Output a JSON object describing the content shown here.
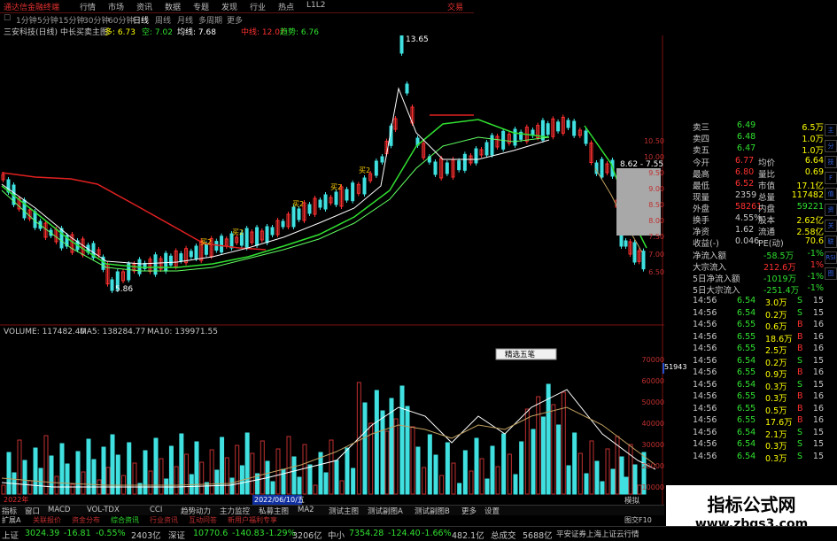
{
  "menu": {
    "app_title": "通达信金融终端",
    "items": [
      "行情",
      "市场",
      "资讯",
      "数据",
      "专题",
      "发现",
      "行业",
      "热点",
      "L1L2"
    ],
    "right_label": "交易"
  },
  "toolbar": {
    "items": [
      "1分钟",
      "5分钟",
      "15分钟",
      "30分钟",
      "60分钟",
      "日线",
      "周线",
      "月线",
      "多周期",
      "更多"
    ],
    "selected": "日线"
  },
  "info": {
    "stock": "三安科技(日线)",
    "indicator": "中长买卖主图",
    "duo": "多: 6.73",
    "kong": "空: 7.02",
    "junxian": "均线: 7.68",
    "zhongxian": "中线: 12.07",
    "qushi": "趋势: 6.76"
  },
  "price_axis": [
    "10.50",
    "10.00",
    "9.50",
    "9.00",
    "8.50",
    "8.00",
    "7.50",
    "7.00",
    "6.50"
  ],
  "volume_axis": [
    "70000",
    "60000",
    "50000",
    "40000",
    "30000",
    "20000",
    "10000"
  ],
  "volume_highlight": "51943",
  "chart_labels": {
    "high": "13.65",
    "low": "5.86",
    "range": "8.62 - 7.55",
    "volume_line": "VOLUME: 117482.40",
    "ma5_line": "MA5: 138284.77",
    "ma10_line": "MA10: 139971.55",
    "popup": "精选五笔",
    "date_start": "2022年",
    "date_cursor": "2022/06/10/五",
    "buy_markers": [
      "买2",
      "买2",
      "买2",
      "买2",
      "买2"
    ]
  },
  "quote": {
    "asks": [
      {
        "label": "卖三",
        "price": "6.49",
        "vol": "6.5万"
      },
      {
        "label": "卖四",
        "price": "6.48",
        "vol": "1.0万"
      },
      {
        "label": "卖五",
        "price": "6.47",
        "vol": "1.0万"
      }
    ],
    "stats": [
      {
        "l1": "今开",
        "v1": "6.77",
        "l2": "均价",
        "v2": "6.64"
      },
      {
        "l1": "最高",
        "v1": "6.80",
        "l2": "量比",
        "v2": "0.69"
      },
      {
        "l1": "最低",
        "v1": "6.52",
        "l2": "市值",
        "v2": "17.1亿"
      },
      {
        "l1": "现量",
        "v1": "2359",
        "l2": "总量",
        "v2": "117482"
      },
      {
        "l1": "外盘",
        "v1": "58261",
        "l2": "内盘",
        "v2": "59221"
      },
      {
        "l1": "换手",
        "v1": "4.55%",
        "l2": "股本",
        "v2": "2.62亿"
      },
      {
        "l1": "净资",
        "v1": "1.62",
        "l2": "流通",
        "v2": "2.58亿"
      },
      {
        "l1": "收益(-)",
        "v1": "0.046",
        "l2": "PE(动)",
        "v2": "70.6"
      }
    ],
    "flows": [
      {
        "label": "净流入额",
        "value": "-58.5万",
        "pct": "-1%"
      },
      {
        "label": "大宗流入",
        "value": "212.6万",
        "pct": "1%"
      },
      {
        "label": "5日净流入额",
        "value": "-1019万",
        "pct": "-1%"
      },
      {
        "label": "5日大宗流入",
        "value": "-251.4万",
        "pct": "-1%"
      }
    ],
    "ticks": [
      {
        "time": "14:56",
        "price": "6.54",
        "vol": "3.0万",
        "side": "S",
        "n": "15"
      },
      {
        "time": "14:56",
        "price": "6.54",
        "vol": "0.2万",
        "side": "S",
        "n": "15"
      },
      {
        "time": "14:56",
        "price": "6.55",
        "vol": "0.6万",
        "side": "B",
        "n": "16"
      },
      {
        "time": "14:56",
        "price": "6.55",
        "vol": "18.6万",
        "side": "B",
        "n": "16"
      },
      {
        "time": "14:56",
        "price": "6.55",
        "vol": "2.5万",
        "side": "B",
        "n": "16"
      },
      {
        "time": "14:56",
        "price": "6.54",
        "vol": "0.2万",
        "side": "S",
        "n": "15"
      },
      {
        "time": "14:56",
        "price": "6.55",
        "vol": "0.9万",
        "side": "B",
        "n": "16"
      },
      {
        "time": "14:56",
        "price": "6.54",
        "vol": "0.3万",
        "side": "S",
        "n": "15"
      },
      {
        "time": "14:56",
        "price": "6.55",
        "vol": "0.3万",
        "side": "B",
        "n": "16"
      },
      {
        "time": "14:56",
        "price": "6.55",
        "vol": "0.5万",
        "side": "B",
        "n": "16"
      },
      {
        "time": "14:56",
        "price": "6.55",
        "vol": "17.6万",
        "side": "B",
        "n": "16"
      },
      {
        "time": "14:56",
        "price": "6.54",
        "vol": "2.1万",
        "side": "S",
        "n": "15"
      },
      {
        "time": "14:56",
        "price": "6.54",
        "vol": "0.3万",
        "side": "S",
        "n": "15"
      },
      {
        "time": "14:56",
        "price": "6.54",
        "vol": "0.3万",
        "side": "S",
        "n": "15"
      }
    ]
  },
  "side_icons": [
    "主",
    "分",
    "技",
    "F",
    "值",
    "资",
    "关",
    "联",
    "RSI",
    "图"
  ],
  "bottom_tabs": [
    "指标",
    "窗口",
    "MACD",
    "VOL-TDX",
    "CCI",
    "趋势动力",
    "主力监控",
    "私募主图",
    "MA2",
    "测试主图",
    "测试副图A",
    "测试副图B",
    "更多",
    "设置"
  ],
  "bottom_tabs2": [
    "扩展A",
    "关联报价",
    "资金分布",
    "综合资讯",
    "行业资讯",
    "互动问答",
    "新用户福利专享"
  ],
  "bottom_right": [
    "图交F10",
    "模拟"
  ],
  "status": {
    "sh_name": "上证",
    "sh_val": "3024.39",
    "sh_chg": "-16.81",
    "sh_pct": "-0.55%",
    "sh_amt": "2403亿",
    "sz_name": "深证",
    "sz_val": "10770.6",
    "sz_chg": "-140.83",
    "sz_pct": "-1.29%",
    "sz_amt": "3206亿",
    "zx_name": "中小",
    "zx_val": "7354.28",
    "zx_chg": "-124.40",
    "zx_pct": "-1.66%",
    "zx_amt": "482.1亿",
    "total_label": "总成交",
    "total_val": "5688亿",
    "server": "平安证券上海上证云行情"
  },
  "watermark": {
    "title": "指标公式网",
    "url": "www.zbgs3.com"
  },
  "colors": {
    "up": "#ff3030",
    "down": "#40e0e0",
    "accent": "#ffff00",
    "green": "#30e030"
  }
}
